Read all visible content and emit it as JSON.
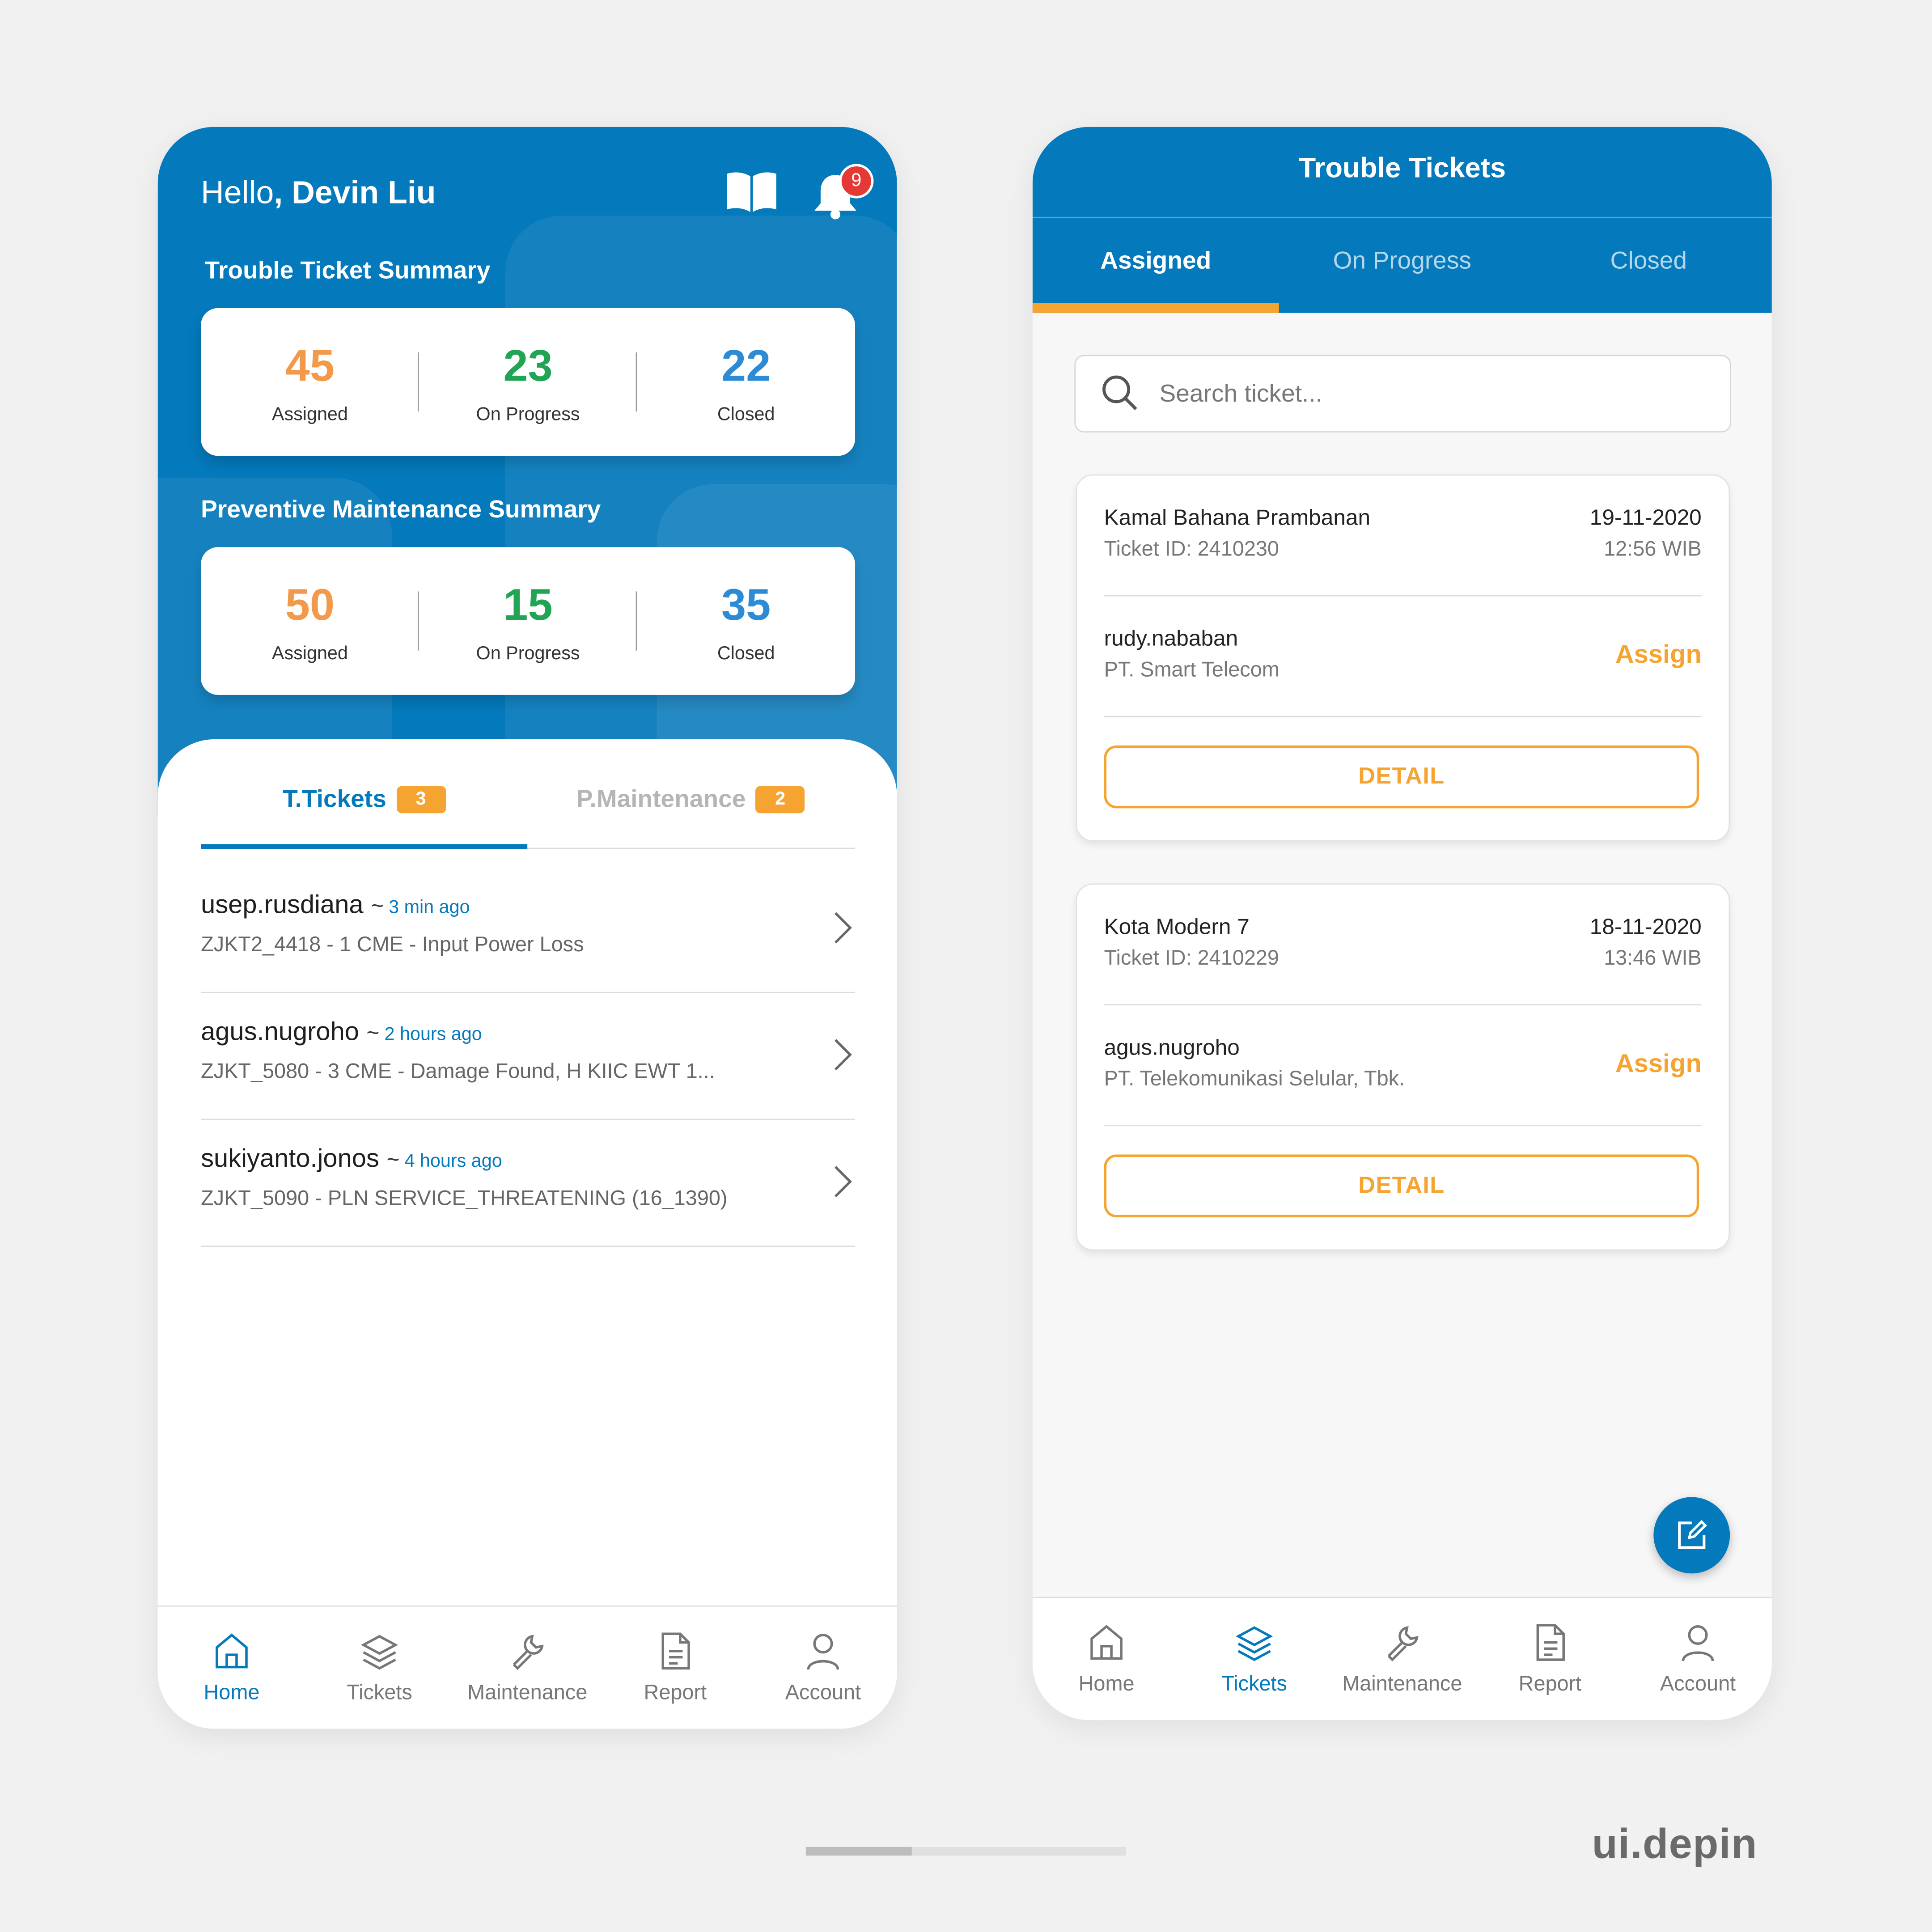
{
  "colors": {
    "primary": "#0479bb",
    "accent": "#f6a431",
    "green": "#21a453",
    "assigned": "#f2994a",
    "closed": "#2d8bd6",
    "alert": "#e53935"
  },
  "home": {
    "greeting_prefix": "Hello",
    "greeting_name": ", Devin Liu",
    "notification_count": "9",
    "trouble_summary": {
      "title": "Trouble Ticket Summary",
      "assigned": {
        "value": "45",
        "label": "Assigned"
      },
      "on_progress": {
        "value": "23",
        "label": "On Progress"
      },
      "closed": {
        "value": "22",
        "label": "Closed"
      }
    },
    "pm_summary": {
      "title": "Preventive Maintenance Summary",
      "assigned": {
        "value": "50",
        "label": "Assigned"
      },
      "on_progress": {
        "value": "15",
        "label": "On Progress"
      },
      "closed": {
        "value": "35",
        "label": "Closed"
      }
    },
    "tabs": [
      {
        "label": "T.Tickets",
        "count": "3"
      },
      {
        "label": "P.Maintenance",
        "count": "2"
      }
    ],
    "tickets": [
      {
        "user": "usep.rusdiana",
        "tilde": "~",
        "ago": "3 min ago",
        "desc": "ZJKT2_4418 - 1 CME - Input Power Loss"
      },
      {
        "user": "agus.nugroho",
        "tilde": "~",
        "ago": "2 hours ago",
        "desc": "ZJKT_5080 - 3 CME - Damage Found, H KIIC EWT 1..."
      },
      {
        "user": "sukiyanto.jonos",
        "tilde": "~",
        "ago": "4 hours ago",
        "desc": "ZJKT_5090 - PLN SERVICE_THREATENING (16_1390)"
      }
    ]
  },
  "nav": {
    "home": "Home",
    "tickets": "Tickets",
    "maintenance": "Maintenance",
    "report": "Report",
    "account": "Account"
  },
  "tickets_page": {
    "title": "Trouble Tickets",
    "tabs": [
      "Assigned",
      "On Progress",
      "Closed"
    ],
    "search_placeholder": "Search ticket...",
    "cards": [
      {
        "location": "Kamal Bahana Prambanan",
        "ticket_id": "Ticket ID: 2410230",
        "date": "19-11-2020",
        "time": "12:56 WIB",
        "user": "rudy.nababan",
        "company": "PT. Smart Telecom",
        "action": "Assign",
        "button": "DETAIL"
      },
      {
        "location": "Kota Modern 7",
        "ticket_id": "Ticket ID: 2410229",
        "date": "18-11-2020",
        "time": "13:46 WIB",
        "user": "agus.nugroho",
        "company": "PT. Telekomunikasi Selular, Tbk.",
        "action": "Assign",
        "button": "DETAIL"
      }
    ]
  },
  "footer": {
    "brand": "ui.depin",
    "scroll_progress": 0.33
  }
}
